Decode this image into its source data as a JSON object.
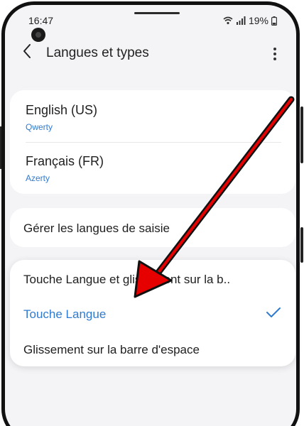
{
  "status": {
    "time": "16:47",
    "battery": "19%"
  },
  "appbar": {
    "title": "Langues et types",
    "back_icon": "back-chevron-icon",
    "more_icon": "more-vert-icon"
  },
  "languages": [
    {
      "name": "English (US)",
      "layout": "Qwerty"
    },
    {
      "name": "Français (FR)",
      "layout": "Azerty"
    }
  ],
  "manage": {
    "label": "Gérer les langues de saisie"
  },
  "switch_options": {
    "items": [
      {
        "label": "Touche Langue et glissement sur la b..",
        "selected": false
      },
      {
        "label": "Touche Langue",
        "selected": true
      },
      {
        "label": "Glissement sur la barre d'espace",
        "selected": false
      }
    ],
    "accent_color": "#2f7bd1"
  },
  "annotation": {
    "arrow_color": "#e60000"
  }
}
